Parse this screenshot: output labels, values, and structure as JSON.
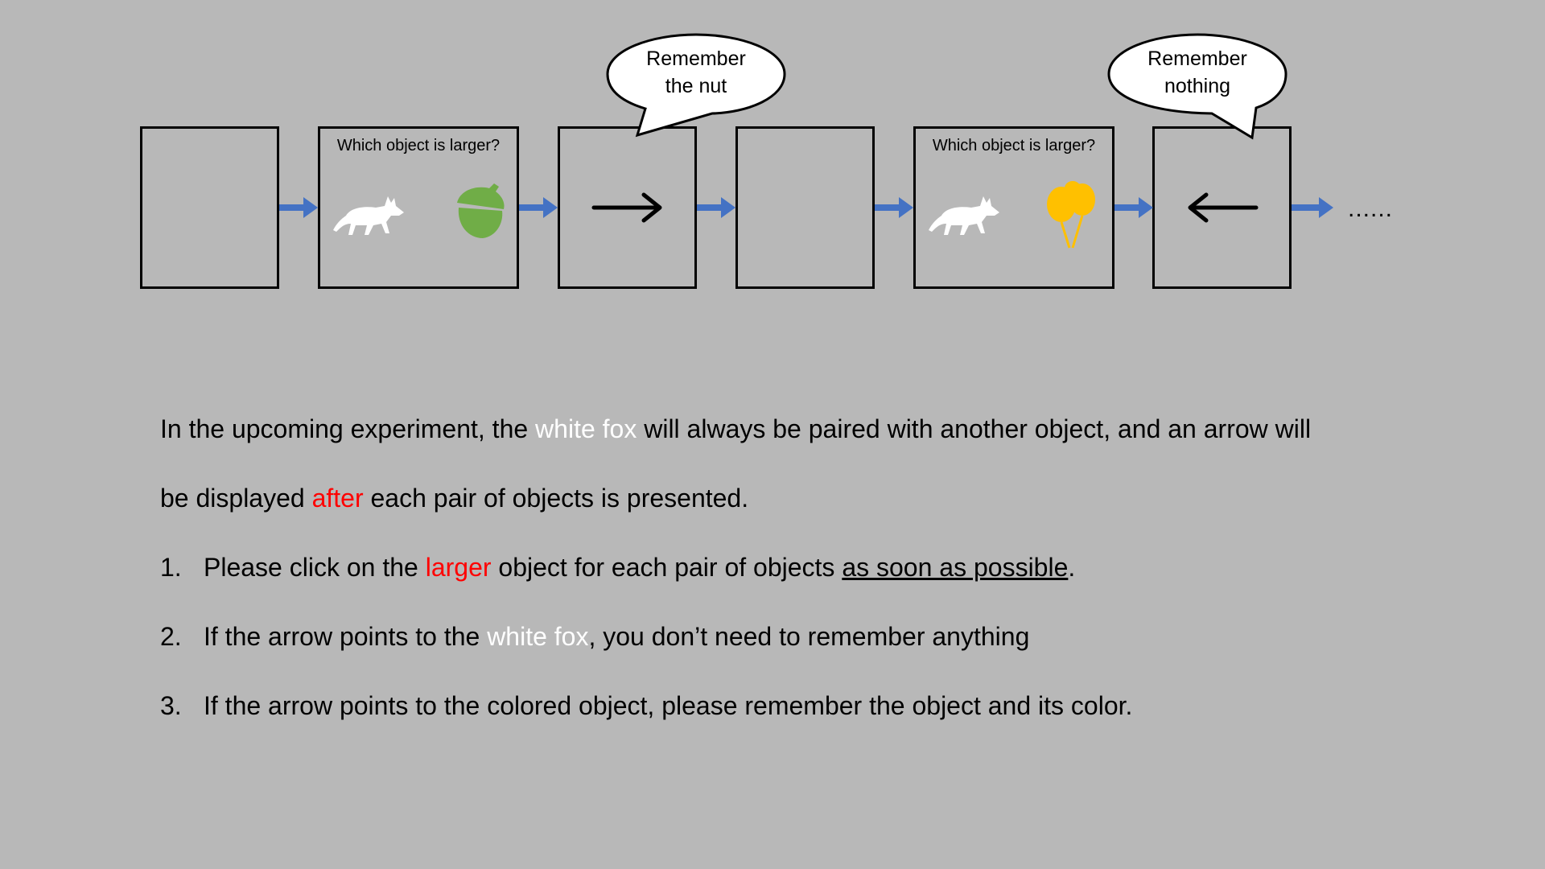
{
  "diagram": {
    "frames": [
      {
        "id": "frame-1",
        "question": ""
      },
      {
        "id": "frame-2",
        "question": "Which object is larger?",
        "left_object": "fox-icon",
        "right_object": "acorn-icon"
      },
      {
        "id": "frame-3",
        "arrow": "right-arrow-icon"
      },
      {
        "id": "frame-4",
        "question": ""
      },
      {
        "id": "frame-5",
        "question": "Which object is larger?",
        "left_object": "fox-icon",
        "right_object": "balloons-icon"
      },
      {
        "id": "frame-6",
        "arrow": "left-arrow-icon"
      }
    ],
    "bubbles": [
      {
        "line1": "Remember",
        "line2": "the nut"
      },
      {
        "line1": "Remember",
        "line2": "nothing"
      }
    ],
    "continuation": "......",
    "colors": {
      "background": "#b8b8b8",
      "flow_arrow": "#4472c4",
      "acorn": "#70ad47",
      "balloons": "#ffc000",
      "fox": "#ffffff",
      "highlight_white": "#ffffff",
      "highlight_red": "#ff0000"
    }
  },
  "instructions": {
    "intro_line1": {
      "before": "In the upcoming experiment, the ",
      "highlight": "white fox",
      "after": " will always be paired with another object, and an arrow will"
    },
    "intro_line2": {
      "before": "be displayed ",
      "highlight": "after",
      "after": " each pair of objects is presented."
    },
    "items": [
      {
        "num": "1.",
        "before": "Please click on the ",
        "highlight": "larger",
        "middle": " object for each pair of objects ",
        "underlined": "as soon as possible",
        "after": "."
      },
      {
        "num": "2.",
        "before": "If the arrow points to the ",
        "highlight": "white fox",
        "after": ", you don’t need to remember anything"
      },
      {
        "num": "3.",
        "text": "If the arrow points to the colored object, please remember the object and its color."
      }
    ]
  }
}
